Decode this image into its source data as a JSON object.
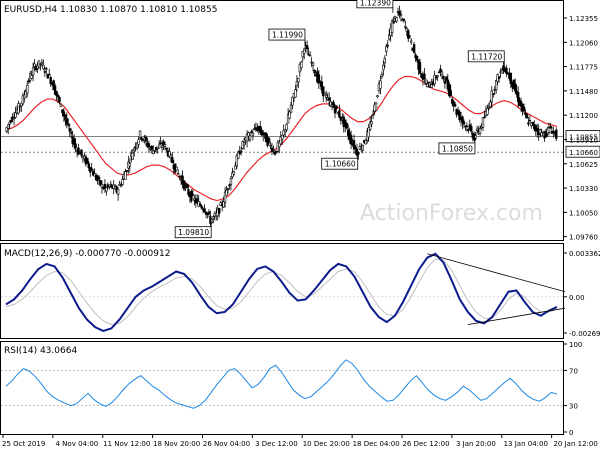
{
  "colors": {
    "background": "#ffffff",
    "frame": "#000000",
    "candle": "#000000",
    "ma": "#e8262a",
    "macd_main": "#0b1a8c",
    "macd_signal": "#c0c0c0",
    "rsi": "#1e88e5",
    "level_line": "#808080",
    "trendline": "#000000",
    "watermark": "#dcdcdc"
  },
  "watermark": "ActionForex.com",
  "chart_data": [
    {
      "type": "candlestick",
      "title": "EURUSD,H4  1.10830 1.10870 1.10810 1.10855",
      "symbol": "EURUSD",
      "timeframe": "H4",
      "ohlc_current": {
        "open": 1.1083,
        "high": 1.1087,
        "low": 1.1081,
        "close": 1.10855
      },
      "ylim": [
        1.0962,
        1.1245
      ],
      "y_ticks": [
        "1.12355",
        "1.12060",
        "1.11775",
        "1.11480",
        "1.11200",
        "1.10910",
        "1.10625",
        "1.10330",
        "1.10050",
        "1.09760"
      ],
      "x_ticks": [
        "25 Oct 2019",
        "4 Nov 04:00",
        "11 Nov 12:00",
        "18 Nov 20:00",
        "26 Nov 04:00",
        "3 Dec 12:00",
        "10 Dec 20:00",
        "18 Dec 04:00",
        "26 Dec 12:00",
        "3 Jan 20:00",
        "13 Jan 04:00",
        "20 Jan 12:00"
      ],
      "price_path": [
        1.1092,
        1.1108,
        1.1118,
        1.1132,
        1.1156,
        1.1172,
        1.1176,
        1.1166,
        1.1152,
        1.1132,
        1.1112,
        1.109,
        1.1072,
        1.1062,
        1.1052,
        1.104,
        1.1028,
        1.102,
        1.1024,
        1.1018,
        1.1032,
        1.1052,
        1.1072,
        1.1088,
        1.1078,
        1.1068,
        1.1072,
        1.1076,
        1.1062,
        1.1046,
        1.1032,
        1.1018,
        1.1008,
        1.1002,
        1.0996,
        1.0981,
        1.0988,
        1.1002,
        1.1024,
        1.1046,
        1.1068,
        1.1082,
        1.109,
        1.1096,
        1.1088,
        1.1076,
        1.1066,
        1.108,
        1.1102,
        1.113,
        1.1162,
        1.1199,
        1.1182,
        1.1162,
        1.1144,
        1.113,
        1.1122,
        1.1112,
        1.1098,
        1.108,
        1.1066,
        1.1076,
        1.1092,
        1.1122,
        1.1158,
        1.1196,
        1.1226,
        1.1239,
        1.1226,
        1.1206,
        1.1184,
        1.1162,
        1.1148,
        1.1154,
        1.1166,
        1.1156,
        1.1136,
        1.1116,
        1.1104,
        1.1096,
        1.1085,
        1.1096,
        1.1114,
        1.1138,
        1.1158,
        1.1172,
        1.116,
        1.1142,
        1.1122,
        1.1106,
        1.1098,
        1.1092,
        1.1088,
        1.1096,
        1.1086
      ],
      "ma_path": [
        1.1094,
        1.1096,
        1.11,
        1.1106,
        1.1114,
        1.1122,
        1.1128,
        1.1132,
        1.1132,
        1.1128,
        1.1122,
        1.1112,
        1.1102,
        1.1092,
        1.1082,
        1.1072,
        1.1062,
        1.1052,
        1.1046,
        1.104,
        1.1038,
        1.1038,
        1.104,
        1.1044,
        1.1048,
        1.105,
        1.105,
        1.1048,
        1.1044,
        1.1038,
        1.1032,
        1.1026,
        1.102,
        1.1016,
        1.1012,
        1.1008,
        1.1006,
        1.1008,
        1.1012,
        1.102,
        1.103,
        1.104,
        1.1048,
        1.1056,
        1.1062,
        1.1066,
        1.107,
        1.1076,
        1.1084,
        1.1094,
        1.1104,
        1.1114,
        1.112,
        1.1124,
        1.1126,
        1.1126,
        1.1124,
        1.112,
        1.1114,
        1.1108,
        1.1104,
        1.1104,
        1.1108,
        1.1116,
        1.1126,
        1.1138,
        1.1148,
        1.1156,
        1.116,
        1.116,
        1.1158,
        1.1154,
        1.1148,
        1.1144,
        1.1142,
        1.114,
        1.1136,
        1.113,
        1.1124,
        1.1118,
        1.1114,
        1.1114,
        1.1118,
        1.1124,
        1.1128,
        1.113,
        1.1128,
        1.1124,
        1.1118,
        1.1114,
        1.111,
        1.1106,
        1.1102,
        1.11,
        1.1098
      ],
      "price_labels": [
        {
          "text": "1.12390",
          "value": 1.1239,
          "index": 66
        },
        {
          "text": "1.11990",
          "value": 1.1199,
          "index": 51
        },
        {
          "text": "1.11720",
          "value": 1.1172,
          "index": 85
        },
        {
          "text": "1.10660",
          "value": 1.1066,
          "index": 60
        },
        {
          "text": "1.10850",
          "value": 1.1085,
          "index": 80
        },
        {
          "text": "1.09810",
          "value": 1.0981,
          "index": 35
        }
      ],
      "levels": [
        {
          "value": 1.1066,
          "label": "1.10660",
          "style": "dotted"
        },
        {
          "value": 1.10855,
          "label": "1.10855",
          "style": "solid"
        }
      ]
    },
    {
      "type": "line",
      "title": "MACD(12,26,9) -0.000770 -0.000912",
      "ylim": [
        -0.0031,
        0.0037
      ],
      "y_ticks": [
        "0.003362",
        "0.00",
        "-0.002691"
      ],
      "series": [
        {
          "name": "MACD",
          "values": [
            -0.0006,
            -0.0002,
            0.0005,
            0.0014,
            0.0022,
            0.0026,
            0.0024,
            0.0015,
            0.0003,
            -0.0009,
            -0.0018,
            -0.0024,
            -0.0027,
            -0.0025,
            -0.0018,
            -0.0009,
            0.0,
            0.0005,
            0.0008,
            0.0012,
            0.0016,
            0.002,
            0.0018,
            0.0011,
            0.0001,
            -0.0008,
            -0.0013,
            -0.0012,
            -0.0006,
            0.0004,
            0.0014,
            0.0022,
            0.0024,
            0.002,
            0.0012,
            0.0003,
            -0.0003,
            -0.0002,
            0.0005,
            0.0013,
            0.0021,
            0.0026,
            0.0024,
            0.0016,
            0.0004,
            -0.0008,
            -0.0016,
            -0.002,
            -0.0015,
            -0.0004,
            0.0009,
            0.0022,
            0.0031,
            0.0034,
            0.0027,
            0.0013,
            -0.0002,
            -0.0012,
            -0.0019,
            -0.0021,
            -0.0016,
            -0.0006,
            0.0004,
            0.0005,
            -0.0004,
            -0.0012,
            -0.0015,
            -0.0011,
            -0.0008
          ]
        },
        {
          "name": "Signal",
          "values": [
            -0.0008,
            -0.0006,
            -0.0002,
            0.0004,
            0.0011,
            0.0017,
            0.002,
            0.0019,
            0.0013,
            0.0004,
            -0.0005,
            -0.0013,
            -0.0019,
            -0.0022,
            -0.0021,
            -0.0016,
            -0.0008,
            -0.0001,
            0.0004,
            0.0008,
            0.0011,
            0.0015,
            0.0016,
            0.0014,
            0.0008,
            0.0,
            -0.0007,
            -0.001,
            -0.0009,
            -0.0004,
            0.0004,
            0.0012,
            0.0018,
            0.002,
            0.0017,
            0.0011,
            0.0004,
            0.0,
            0.0002,
            0.0008,
            0.0014,
            0.002,
            0.0022,
            0.002,
            0.0012,
            0.0002,
            -0.0008,
            -0.0014,
            -0.0015,
            -0.001,
            0.0,
            0.0012,
            0.0023,
            0.003,
            0.0029,
            0.0021,
            0.0009,
            -0.0003,
            -0.0012,
            -0.0017,
            -0.0017,
            -0.0011,
            -0.0002,
            0.0003,
            0.0,
            -0.0007,
            -0.0012,
            -0.0012,
            -0.001
          ]
        }
      ],
      "trendlines": [
        {
          "from": [
            52,
            0.0034
          ],
          "to": [
            69,
            0.0004
          ]
        },
        {
          "from": [
            57,
            -0.0022
          ],
          "to": [
            69,
            -0.0009
          ]
        }
      ]
    },
    {
      "type": "line",
      "title": "RSI(14) 43.0664",
      "ylim": [
        0,
        100
      ],
      "y_ticks": [
        "100",
        "70",
        "30",
        "0"
      ],
      "levels": [
        70,
        30
      ],
      "series": [
        {
          "name": "RSI",
          "values": [
            52,
            58,
            66,
            72,
            69,
            63,
            55,
            46,
            40,
            36,
            33,
            30,
            32,
            38,
            44,
            37,
            32,
            29,
            33,
            40,
            48,
            55,
            60,
            64,
            58,
            52,
            48,
            42,
            37,
            33,
            31,
            29,
            27,
            30,
            36,
            45,
            54,
            62,
            70,
            72,
            66,
            58,
            50,
            54,
            62,
            72,
            76,
            68,
            58,
            48,
            42,
            38,
            40,
            46,
            52,
            58,
            66,
            75,
            82,
            78,
            70,
            60,
            52,
            46,
            40,
            35,
            36,
            42,
            50,
            58,
            64,
            56,
            48,
            42,
            38,
            36,
            40,
            45,
            52,
            48,
            42,
            36,
            38,
            44,
            50,
            56,
            61,
            55,
            47,
            41,
            37,
            35,
            39,
            45,
            43
          ]
        }
      ]
    }
  ]
}
